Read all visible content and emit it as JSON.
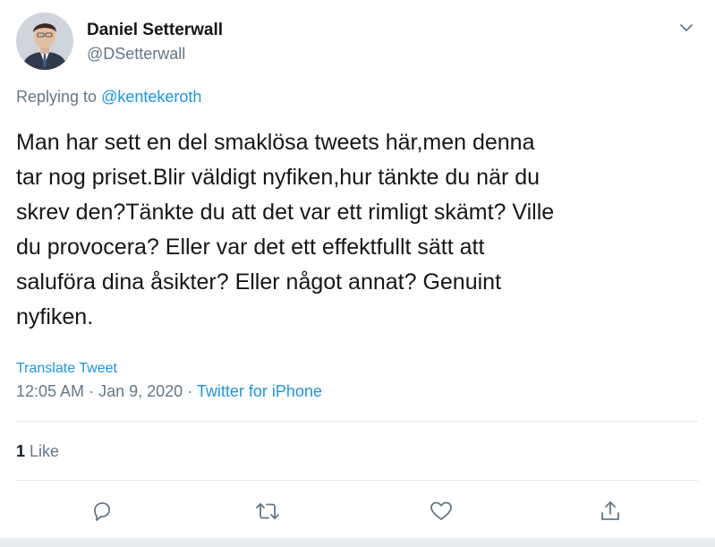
{
  "author": {
    "name": "Daniel Setterwall",
    "handle": "@DSetterwall",
    "avatar_icon": "profile-photo"
  },
  "reply": {
    "prefix": "Replying to",
    "target": "@kentekeroth"
  },
  "tweet": {
    "lines": [
      "Man har sett en del smaklösa tweets här,men denna",
      "tar nog priset.Blir väldigt nyfiken,hur tänkte du när du",
      "skrev den?Tänkte du att det var ett rimligt skämt? Ville",
      "du provocera? Eller var det ett effektfullt sätt att",
      "saluföra dina åsikter? Eller något annat? Genuint",
      "nyfiken."
    ],
    "translate_label": "Translate Tweet",
    "time": "12:05 AM",
    "date": "Jan 9, 2020",
    "separator": "·",
    "source": "Twitter for iPhone"
  },
  "stats": {
    "likes_count": "1",
    "likes_label": "Like"
  },
  "actions": {
    "reply_icon": "reply-icon",
    "retweet_icon": "retweet-icon",
    "like_icon": "heart-icon",
    "share_icon": "share-icon"
  },
  "colors": {
    "link": "#1b95e0",
    "secondary_text": "#657786",
    "divider": "#e1e8ed"
  }
}
